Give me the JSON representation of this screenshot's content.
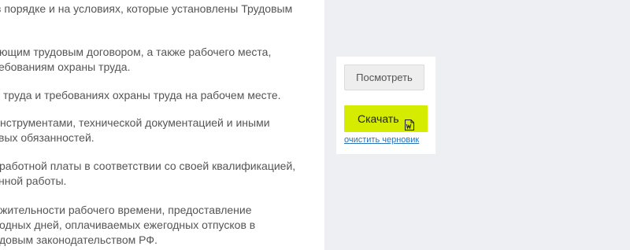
{
  "document": {
    "lines": [
      "в порядке и на условиях, которые установлены Трудовым",
      "",
      "ющим трудовым договором, а также рабочего места,",
      "ебованиям охраны труда.",
      "труда и требованиях охраны труда на рабочем месте.",
      "нструментами, технической документацией и иными",
      "вых обязанностей.",
      "работной платы в соответствии со своей квалификацией,",
      "нной работы.",
      "жительности рабочего времени, предоставление",
      "одных дней, оплачиваемых ежегодных отпусков в",
      "довым законодательством РФ."
    ]
  },
  "actions": {
    "view_label": "Посмотреть",
    "download_label": "Скачать",
    "download_icon": "word-document-icon",
    "clear_draft_label": "очистить черновик"
  },
  "colors": {
    "download_button": "#d5ec00",
    "link": "#2b73b8",
    "background": "#eeeff2",
    "text": "#555555"
  }
}
